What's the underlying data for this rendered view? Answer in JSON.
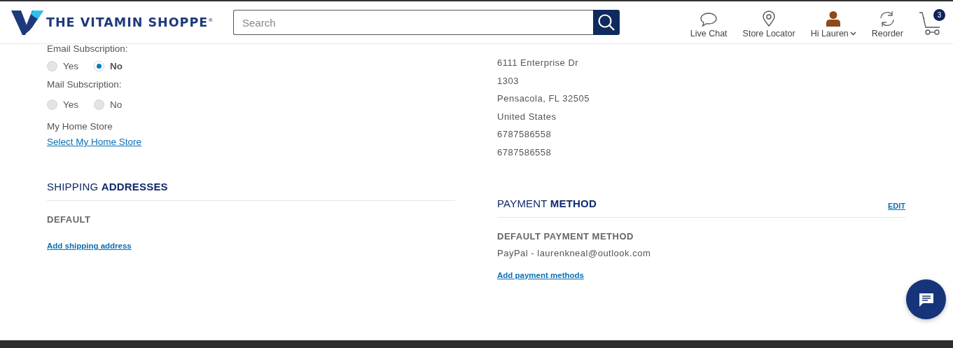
{
  "header": {
    "logo": "THE VITAMIN SHOPPE",
    "logo_mark": "®",
    "search": {
      "placeholder": "Search"
    },
    "nav": [
      {
        "kind": "chat",
        "label": "Live Chat"
      },
      {
        "kind": "locator",
        "label": "Store Locator"
      },
      {
        "kind": "account",
        "label": "Hi Lauren"
      },
      {
        "kind": "reorder",
        "label": "Reorder"
      },
      {
        "kind": "cart",
        "count": "3"
      }
    ]
  },
  "preferences": [
    {
      "label": "Email Subscription:",
      "options": [
        {
          "label": "Yes",
          "selected": false
        },
        {
          "label": "No",
          "selected": true
        }
      ]
    },
    {
      "label": "Mail Subscription:",
      "options": [
        {
          "label": "Yes",
          "selected": false
        },
        {
          "label": "No",
          "selected": false
        }
      ]
    }
  ],
  "home_store": {
    "label": "My Home Store",
    "link": "Select My Home Store"
  },
  "shipping": {
    "heading": "SHIPPING **ADDRESSES**",
    "default_label": "DEFAULT",
    "add_link": "Add shipping address"
  },
  "billing_lines": [
    "6111 Enterprise Dr",
    "1303",
    "Pensacola, FL 32505",
    "United States",
    "6787586558",
    "6787586558"
  ],
  "payment": {
    "heading": "PAYMENT **METHOD**",
    "edit": "EDIT",
    "default_label": "DEFAULT PAYMENT METHOD",
    "method": "PayPal - laurenkneal@outlook.com",
    "add_link": "Add payment methods"
  }
}
